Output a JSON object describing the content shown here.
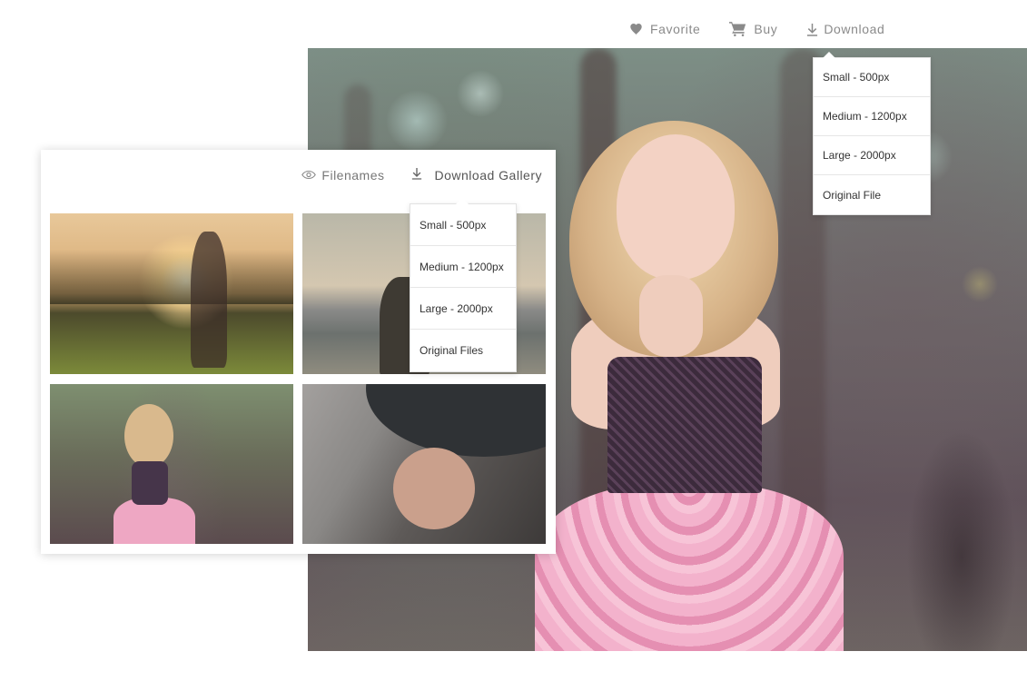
{
  "toolbar": {
    "favorite": {
      "label": "Favorite",
      "icon": "heart-icon"
    },
    "buy": {
      "label": "Buy",
      "icon": "cart-icon"
    },
    "download": {
      "label": "Download",
      "icon": "download-icon"
    }
  },
  "download_menu": {
    "items": [
      "Small - 500px",
      "Medium - 1200px",
      "Large - 2000px",
      "Original File"
    ]
  },
  "gallery": {
    "toolbar": {
      "filenames": {
        "label": "Filenames",
        "icon": "eye-icon"
      },
      "download_gallery": {
        "label": "Download Gallery",
        "icon": "download-icon"
      }
    },
    "download_menu": {
      "items": [
        "Small - 500px",
        "Medium - 1200px",
        "Large - 2000px",
        "Original Files"
      ]
    }
  },
  "colors": {
    "toolbar_text": "#8a8a8a",
    "menu_text": "#333333",
    "divider": "#e6e6e6"
  }
}
